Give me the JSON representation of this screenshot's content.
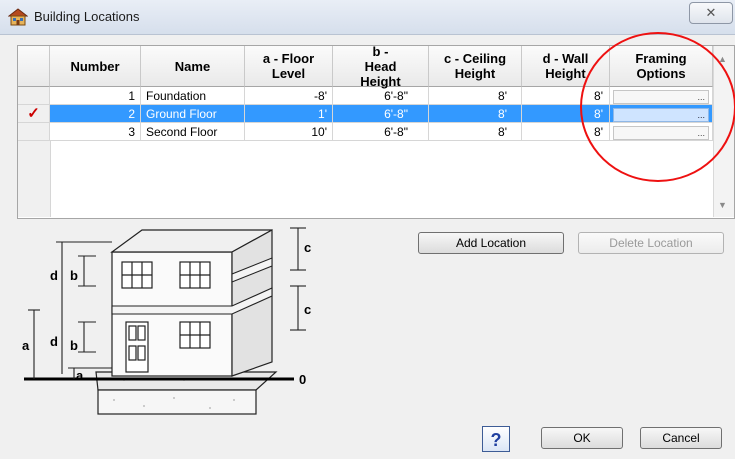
{
  "window": {
    "title": "Building Locations",
    "close_glyph": "✕"
  },
  "table": {
    "headers": {
      "number": "Number",
      "name": "Name",
      "floor_level": "a - Floor Level",
      "head_height": "b - Head Height",
      "ceiling_height": "c - Ceiling Height",
      "wall_height": "d - Wall Height",
      "framing_options": "Framing Options"
    },
    "rows": [
      {
        "selected": false,
        "number": "1",
        "name": "Foundation",
        "floor_level": "-8'",
        "head_height": "6'-8\"",
        "ceiling_height": "8'",
        "wall_height": "8'",
        "framing_options": "..."
      },
      {
        "selected": true,
        "marker": "✓",
        "number": "2",
        "name": "Ground Floor",
        "floor_level": "1'",
        "head_height": "6'-8\"",
        "ceiling_height": "8'",
        "wall_height": "8'",
        "framing_options": "..."
      },
      {
        "selected": false,
        "number": "3",
        "name": "Second Floor",
        "floor_level": "10'",
        "head_height": "6'-8\"",
        "ceiling_height": "8'",
        "wall_height": "8'",
        "framing_options": "..."
      }
    ]
  },
  "buttons": {
    "add_location": "Add Location",
    "delete_location": "Delete Location",
    "help": "?",
    "ok": "OK",
    "cancel": "Cancel"
  },
  "diagram": {
    "labels": {
      "a": "a",
      "b": "b",
      "c": "c",
      "d": "d",
      "zero": "0"
    }
  },
  "colors": {
    "selection": "#3399ff",
    "annotation_circle": "#e11111",
    "check": "#cc0000"
  }
}
